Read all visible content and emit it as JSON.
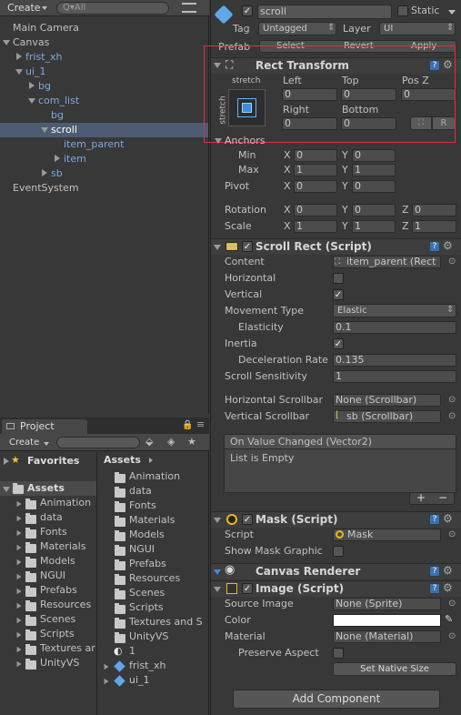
{
  "hierarchy": {
    "create_label": "Create",
    "search_placeholder": "Q▾All",
    "items": [
      "Main Camera",
      "Canvas",
      "frist_xh",
      "ui_1",
      "bg",
      "com_list",
      "bg",
      "scroll",
      "item_parent",
      "item",
      "sb",
      "EventSystem"
    ]
  },
  "project": {
    "tab_label": "Project",
    "create_label": "Create",
    "favorites_label": "Favorites",
    "assets_label": "Assets",
    "tree": [
      "Animation",
      "data",
      "Fonts",
      "Materials",
      "Models",
      "NGUI",
      "Prefabs",
      "Resources",
      "Scenes",
      "Scripts",
      "Textures ar",
      "UnityVS"
    ],
    "assets_header": "Assets",
    "assets_items": [
      "Animation",
      "data",
      "Fonts",
      "Materials",
      "Models",
      "NGUI",
      "Prefabs",
      "Resources",
      "Scenes",
      "Scripts",
      "Textures and S",
      "UnityVS",
      "1",
      "frist_xh",
      "ui_1"
    ]
  },
  "inspector": {
    "object_name": "scroll",
    "static_label": "Static",
    "tag_label": "Tag",
    "tag_value": "Untagged",
    "layer_label": "Layer",
    "layer_value": "UI",
    "prefab_label": "Prefab",
    "select_label": "Select",
    "revert_label": "Revert",
    "apply_label": "Apply",
    "rect_transform": {
      "title": "Rect Transform",
      "stretch_top": "stretch",
      "stretch_side": "stretch",
      "left_label": "Left",
      "left_value": "0",
      "top_label": "Top",
      "top_value": "0",
      "posz_label": "Pos Z",
      "posz_value": "0",
      "right_label": "Right",
      "right_value": "0",
      "bottom_label": "Bottom",
      "bottom_value": "0",
      "r_label": "R",
      "anchors_label": "Anchors",
      "min_label": "Min",
      "max_label": "Max",
      "min_x": "0",
      "min_y": "0",
      "max_x": "1",
      "max_y": "1",
      "pivot_label": "Pivot",
      "pivot_x": "0",
      "pivot_y": "0",
      "rotation_label": "Rotation",
      "rot_x": "0",
      "rot_y": "0",
      "rot_z": "0",
      "scale_label": "Scale",
      "scale_x": "1",
      "scale_y": "1",
      "scale_z": "1",
      "x": "X",
      "y": "Y",
      "z": "Z"
    },
    "scroll_rect": {
      "title": "Scroll Rect (Script)",
      "content_label": "Content",
      "content_value": "item_parent (Rect",
      "horizontal_label": "Horizontal",
      "horizontal": false,
      "vertical_label": "Vertical",
      "vertical": true,
      "movement_label": "Movement Type",
      "movement_value": "Elastic",
      "elasticity_label": "Elasticity",
      "elasticity_value": "0.1",
      "inertia_label": "Inertia",
      "inertia": true,
      "decel_label": "Deceleration Rate",
      "decel_value": "0.135",
      "sensitivity_label": "Scroll Sensitivity",
      "sensitivity_value": "1",
      "hscroll_label": "Horizontal Scrollbar",
      "hscroll_value": "None (Scrollbar)",
      "vscroll_label": "Vertical Scrollbar",
      "vscroll_value": "sb (Scrollbar)",
      "event_label": "On Value Changed (Vector2)",
      "event_empty": "List is Empty",
      "plus": "+",
      "minus": "−"
    },
    "mask": {
      "title": "Mask (Script)",
      "script_label": "Script",
      "script_value": "Mask",
      "show_label": "Show Mask Graphic"
    },
    "canvas_renderer": {
      "title": "Canvas Renderer"
    },
    "image": {
      "title": "Image (Script)",
      "source_label": "Source Image",
      "source_value": "None (Sprite)",
      "color_label": "Color",
      "material_label": "Material",
      "material_value": "None (Material)",
      "preserve_label": "Preserve Aspect",
      "native_label": "Set Native Size"
    },
    "add_component_label": "Add Component"
  },
  "colors": {
    "highlight": "#e0303c",
    "selection": "#4d5c72",
    "blue_text": "#7fa8e0"
  }
}
